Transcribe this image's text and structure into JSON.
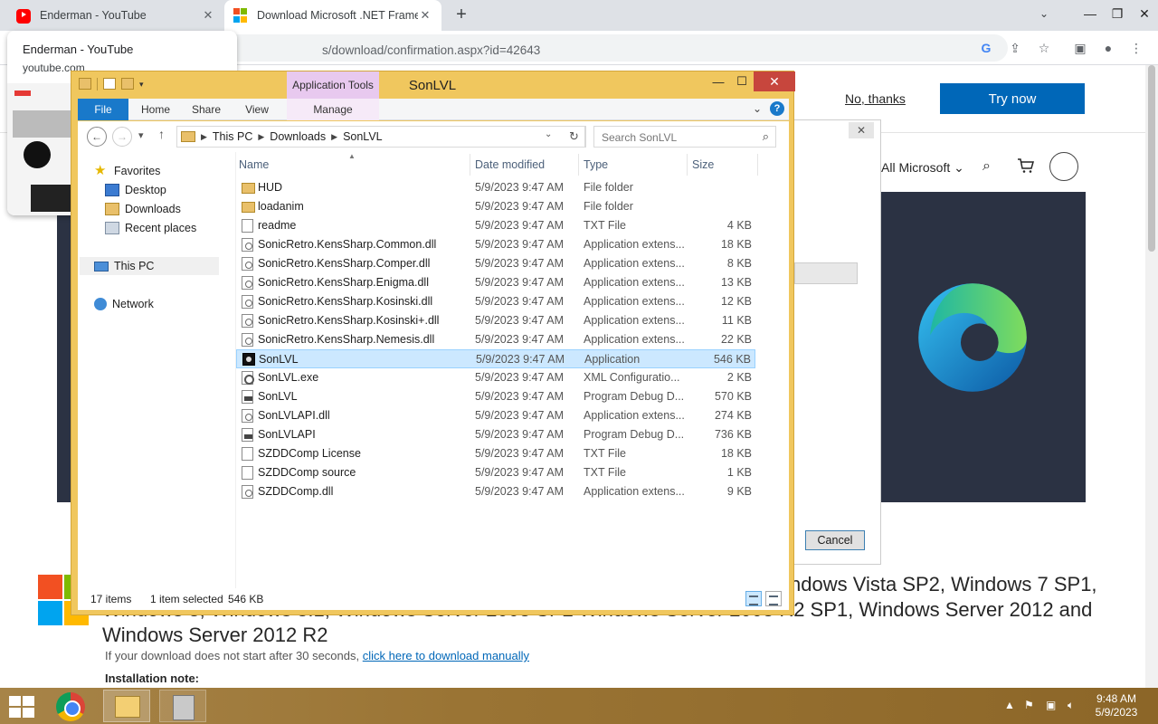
{
  "browser": {
    "tabs": [
      {
        "title": "Enderman - YouTube",
        "favicon": "youtube-icon"
      },
      {
        "title": "Download Microsoft .NET Framework",
        "favicon": "microsoft-icon",
        "active": true
      }
    ],
    "url": "s/download/confirmation.aspx?id=42643",
    "hovercard": {
      "title": "Enderman - YouTube",
      "domain": "youtube.com"
    }
  },
  "page": {
    "no_thanks": "No, thanks",
    "try_now": "Try now",
    "all_microsoft": "All Microsoft",
    "cancel": "Cancel",
    "sysreq_line1": "ndows Vista SP2, Windows 7 SP1,",
    "sysreq_line2": "Windows 8, Windows 8.1, Windows Server 2008 SP2 Windows Server 2008 R2 SP1, Windows Server 2012 and",
    "sysreq_line3": "Windows Server 2012 R2",
    "download_note": "If your download does not start after 30 seconds,",
    "download_link": "click here to download manually",
    "installation_note": "Installation note:"
  },
  "explorer": {
    "title": "SonLVL",
    "context_tab": "Application Tools",
    "ribbon_tabs": {
      "file": "File",
      "home": "Home",
      "share": "Share",
      "view": "View",
      "manage": "Manage"
    },
    "breadcrumb": [
      "This PC",
      "Downloads",
      "SonLVL"
    ],
    "search_placeholder": "Search SonLVL",
    "nav": {
      "favorites": "Favorites",
      "desktop": "Desktop",
      "downloads": "Downloads",
      "recent": "Recent places",
      "this_pc": "This PC",
      "network": "Network"
    },
    "columns": {
      "name": "Name",
      "date": "Date modified",
      "type": "Type",
      "size": "Size"
    },
    "files": [
      {
        "name": "HUD",
        "date": "5/9/2023 9:47 AM",
        "type": "File folder",
        "size": "",
        "icon": "folder"
      },
      {
        "name": "loadanim",
        "date": "5/9/2023 9:47 AM",
        "type": "File folder",
        "size": "",
        "icon": "folder"
      },
      {
        "name": "readme",
        "date": "5/9/2023 9:47 AM",
        "type": "TXT File",
        "size": "4 KB",
        "icon": "txt"
      },
      {
        "name": "SonicRetro.KensSharp.Common.dll",
        "date": "5/9/2023 9:47 AM",
        "type": "Application extens...",
        "size": "18 KB",
        "icon": "dll"
      },
      {
        "name": "SonicRetro.KensSharp.Comper.dll",
        "date": "5/9/2023 9:47 AM",
        "type": "Application extens...",
        "size": "8 KB",
        "icon": "dll"
      },
      {
        "name": "SonicRetro.KensSharp.Enigma.dll",
        "date": "5/9/2023 9:47 AM",
        "type": "Application extens...",
        "size": "13 KB",
        "icon": "dll"
      },
      {
        "name": "SonicRetro.KensSharp.Kosinski.dll",
        "date": "5/9/2023 9:47 AM",
        "type": "Application extens...",
        "size": "12 KB",
        "icon": "dll"
      },
      {
        "name": "SonicRetro.KensSharp.Kosinski+.dll",
        "date": "5/9/2023 9:47 AM",
        "type": "Application extens...",
        "size": "11 KB",
        "icon": "dll"
      },
      {
        "name": "SonicRetro.KensSharp.Nemesis.dll",
        "date": "5/9/2023 9:47 AM",
        "type": "Application extens...",
        "size": "22 KB",
        "icon": "dll"
      },
      {
        "name": "SonLVL",
        "date": "5/9/2023 9:47 AM",
        "type": "Application",
        "size": "546 KB",
        "icon": "app",
        "selected": true
      },
      {
        "name": "SonLVL.exe",
        "date": "5/9/2023 9:47 AM",
        "type": "XML Configuratio...",
        "size": "2 KB",
        "icon": "cfg"
      },
      {
        "name": "SonLVL",
        "date": "5/9/2023 9:47 AM",
        "type": "Program Debug D...",
        "size": "570 KB",
        "icon": "pdb"
      },
      {
        "name": "SonLVLAPI.dll",
        "date": "5/9/2023 9:47 AM",
        "type": "Application extens...",
        "size": "274 KB",
        "icon": "dll"
      },
      {
        "name": "SonLVLAPI",
        "date": "5/9/2023 9:47 AM",
        "type": "Program Debug D...",
        "size": "736 KB",
        "icon": "pdb"
      },
      {
        "name": "SZDDComp License",
        "date": "5/9/2023 9:47 AM",
        "type": "TXT File",
        "size": "18 KB",
        "icon": "txt"
      },
      {
        "name": "SZDDComp source",
        "date": "5/9/2023 9:47 AM",
        "type": "TXT File",
        "size": "1 KB",
        "icon": "txt"
      },
      {
        "name": "SZDDComp.dll",
        "date": "5/9/2023 9:47 AM",
        "type": "Application extens...",
        "size": "9 KB",
        "icon": "dll"
      }
    ],
    "status": {
      "count": "17 items",
      "selected": "1 item selected",
      "size": "546 KB"
    }
  },
  "taskbar": {
    "time": "9:48 AM",
    "date": "5/9/2023"
  },
  "colors": {
    "explorer_frame": "#f0c75e",
    "ribbon_file": "#1979ca",
    "selection": "#cce8ff",
    "ms_blue": "#0067b8",
    "taskbar": "#9a7434"
  }
}
